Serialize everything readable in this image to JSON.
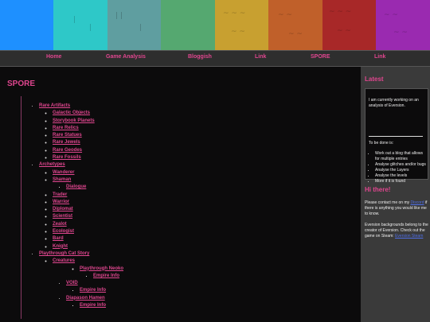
{
  "banner": {
    "colors": [
      "#1e90ff",
      "#2ec8c8",
      "#5f9ea0",
      "#55a870",
      "#c8a030",
      "#c0602a",
      "#a82828",
      "#9a2ab0"
    ]
  },
  "nav": {
    "items": [
      {
        "label": "Home"
      },
      {
        "label": "Game Analysis"
      },
      {
        "label": "Bloggish"
      },
      {
        "label": "Link"
      },
      {
        "label": "SPORE"
      },
      {
        "label": "Link"
      }
    ]
  },
  "main": {
    "title": "SPORE",
    "tree": [
      {
        "label": "Rare Artifacts",
        "children": [
          {
            "label": "Galactic Objects"
          },
          {
            "label": "Storybook Planets"
          },
          {
            "label": "Rare Relics"
          },
          {
            "label": "Rare Statues"
          },
          {
            "label": "Rare Jewels"
          },
          {
            "label": "Rare Geodes"
          },
          {
            "label": "Rare Fossils"
          }
        ]
      },
      {
        "label": "Archetypes",
        "children": [
          {
            "label": "Wanderer"
          },
          {
            "label": "Shaman",
            "children": [
              {
                "label": "Dialogue"
              }
            ]
          },
          {
            "label": "Trader"
          },
          {
            "label": "Warrior"
          },
          {
            "label": "Diplomat"
          },
          {
            "label": "Scientist"
          },
          {
            "label": "Zealot"
          },
          {
            "label": "Ecologist"
          },
          {
            "label": "Bard"
          },
          {
            "label": "Knight"
          }
        ]
      },
      {
        "label": "Playthrough Cat Story",
        "children": [
          {
            "label": "Creatures",
            "children": [
              {
                "label": "Playthrough Neoko",
                "children": [
                  {
                    "label": "Empire Info"
                  }
                ]
              },
              {
                "label": "VOID",
                "children": [
                  {
                    "label": "Empire Info"
                  }
                ]
              },
              {
                "label": "Diapason Hamen",
                "children": [
                  {
                    "label": "Empire Info"
                  }
                ]
              }
            ]
          }
        ]
      }
    ]
  },
  "sidebar": {
    "latest_title": "Latest",
    "latest_intro": "I am currently working on an analysis of Eversion.",
    "todo_label": "To be done is:",
    "todo_items": [
      "Work out a blog that allows for multiple entries",
      "Analyse glitches and/or bugs",
      "Analyse the Layers",
      "Analyse the levels",
      "More if it is found"
    ],
    "hi_title": "Hi there!",
    "contact_pre": "Please contact me on my",
    "contact_link": "Discord",
    "contact_post": "if there is anything you would like me to know.",
    "credit_text": "Eversion backgrounds belong to the creator of Eversion. Check out the game on Steam:",
    "credit_link": "Eversion Steam"
  }
}
